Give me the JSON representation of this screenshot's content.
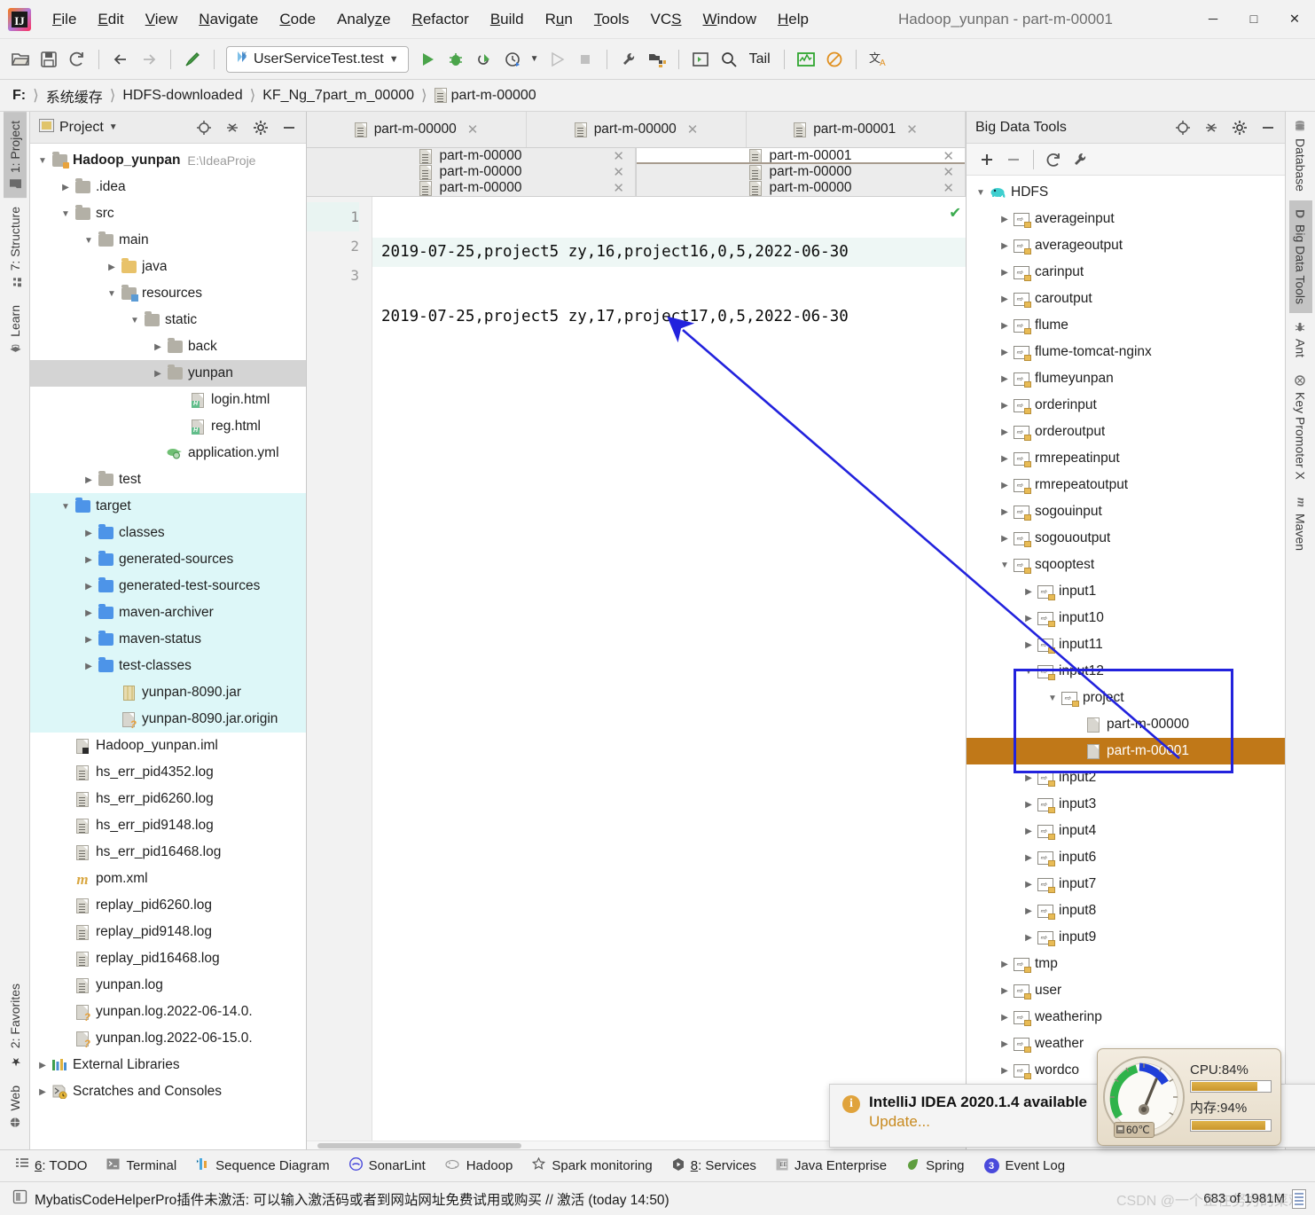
{
  "window": {
    "title": "Hadoop_yunpan - part-m-00001",
    "minimize": "─",
    "maximize": "□",
    "close": "✕"
  },
  "menu": [
    {
      "label": "File",
      "accel": "F"
    },
    {
      "label": "Edit",
      "accel": "E"
    },
    {
      "label": "View",
      "accel": "V"
    },
    {
      "label": "Navigate",
      "accel": "N"
    },
    {
      "label": "Code",
      "accel": "C"
    },
    {
      "label": "Analyze",
      "accel": "z"
    },
    {
      "label": "Refactor",
      "accel": "R"
    },
    {
      "label": "Build",
      "accel": "B"
    },
    {
      "label": "Run",
      "accel": "n"
    },
    {
      "label": "Tools",
      "accel": "T"
    },
    {
      "label": "VCS",
      "accel": "S"
    },
    {
      "label": "Window",
      "accel": "W"
    },
    {
      "label": "Help",
      "accel": "H"
    }
  ],
  "toolbar": {
    "run_config": "UserServiceTest.test",
    "tail_label": "Tail",
    "icons": [
      "open-folder-icon",
      "save-icon",
      "sync-icon",
      "back-arrow-icon",
      "forward-arrow-icon",
      "hammer-icon",
      "run-icon",
      "debug-icon",
      "run-coverage-icon",
      "profile-icon",
      "profile-dropdown-icon",
      "run-disabled-icon",
      "stop-disabled-icon",
      "wrench-icon",
      "project-structure-icon",
      "console-icon",
      "search-icon",
      "chart-icon",
      "no-entry-icon",
      "translate-icon"
    ]
  },
  "breadcrumbs": [
    {
      "label": "F:",
      "icon": null
    },
    {
      "label": "系统缓存",
      "icon": null
    },
    {
      "label": "HDFS-downloaded",
      "icon": null
    },
    {
      "label": "KF_Ng_7part_m_00000",
      "icon": null
    },
    {
      "label": "part-m-00000",
      "icon": "file-icon"
    }
  ],
  "left_stripe": {
    "top": [
      {
        "label": "1: Project",
        "icon": "folder-icon",
        "active": true
      },
      {
        "label": "7: Structure",
        "icon": "structure-icon",
        "active": false
      },
      {
        "label": "Learn",
        "icon": "graduation-cap-icon",
        "active": false
      }
    ],
    "bottom": [
      {
        "label": "2: Favorites",
        "icon": "star-icon",
        "active": false
      },
      {
        "label": "Web",
        "icon": "globe-icon",
        "active": false
      }
    ]
  },
  "right_stripe": [
    {
      "label": "Database",
      "icon": "database-icon",
      "active": false
    },
    {
      "label": "Big Data Tools",
      "icon": "big-data-icon",
      "active": true
    },
    {
      "label": "Ant",
      "icon": "ant-icon",
      "active": false
    },
    {
      "label": "Key Promoter X",
      "icon": "key-promoter-icon",
      "active": false
    },
    {
      "label": "Maven",
      "icon": "maven-icon",
      "active": false
    }
  ],
  "project_panel": {
    "title": "Project",
    "header_icons": [
      "locate-icon",
      "collapse-all-icon",
      "gear-icon",
      "hide-icon"
    ],
    "tree": [
      {
        "depth": 0,
        "label": "Hadoop_yunpan",
        "path": "E:\\IdeaProje",
        "icon": "module-folder-icon",
        "arrow": "down",
        "bold": true
      },
      {
        "depth": 1,
        "label": ".idea",
        "icon": "folder-grey-icon",
        "arrow": "right"
      },
      {
        "depth": 1,
        "label": "src",
        "icon": "folder-grey-icon",
        "arrow": "down"
      },
      {
        "depth": 2,
        "label": "main",
        "icon": "folder-grey-icon",
        "arrow": "down"
      },
      {
        "depth": 3,
        "label": "java",
        "icon": "folder-source-icon",
        "arrow": "right"
      },
      {
        "depth": 3,
        "label": "resources",
        "icon": "folder-resources-icon",
        "arrow": "down"
      },
      {
        "depth": 4,
        "label": "static",
        "icon": "folder-grey-icon",
        "arrow": "down"
      },
      {
        "depth": 5,
        "label": "back",
        "icon": "folder-grey-icon",
        "arrow": "right"
      },
      {
        "depth": 5,
        "label": "yunpan",
        "icon": "folder-grey-icon",
        "arrow": "right",
        "selected": true
      },
      {
        "depth": 6,
        "label": "login.html",
        "icon": "html-file-icon",
        "arrow": "none"
      },
      {
        "depth": 6,
        "label": "reg.html",
        "icon": "html-file-icon",
        "arrow": "none"
      },
      {
        "depth": 5,
        "label": "application.yml",
        "icon": "yml-file-icon",
        "arrow": "none"
      },
      {
        "depth": 2,
        "label": "test",
        "icon": "folder-grey-icon",
        "arrow": "right"
      },
      {
        "depth": 1,
        "label": "target",
        "icon": "folder-blue-icon",
        "arrow": "down",
        "excluded": true
      },
      {
        "depth": 2,
        "label": "classes",
        "icon": "folder-blue-icon",
        "arrow": "right",
        "excluded": true
      },
      {
        "depth": 2,
        "label": "generated-sources",
        "icon": "folder-blue-icon",
        "arrow": "right",
        "excluded": true
      },
      {
        "depth": 2,
        "label": "generated-test-sources",
        "icon": "folder-blue-icon",
        "arrow": "right",
        "excluded": true
      },
      {
        "depth": 2,
        "label": "maven-archiver",
        "icon": "folder-blue-icon",
        "arrow": "right",
        "excluded": true
      },
      {
        "depth": 2,
        "label": "maven-status",
        "icon": "folder-blue-icon",
        "arrow": "right",
        "excluded": true
      },
      {
        "depth": 2,
        "label": "test-classes",
        "icon": "folder-blue-icon",
        "arrow": "right",
        "excluded": true
      },
      {
        "depth": 3,
        "label": "yunpan-8090.jar",
        "icon": "jar-file-icon",
        "arrow": "none",
        "excluded": true
      },
      {
        "depth": 3,
        "label": "yunpan-8090.jar.origin",
        "icon": "unknown-file-icon",
        "arrow": "none",
        "excluded": true
      },
      {
        "depth": 1,
        "label": "Hadoop_yunpan.iml",
        "icon": "iml-file-icon",
        "arrow": "none"
      },
      {
        "depth": 1,
        "label": "hs_err_pid4352.log",
        "icon": "log-file-icon",
        "arrow": "none"
      },
      {
        "depth": 1,
        "label": "hs_err_pid6260.log",
        "icon": "log-file-icon",
        "arrow": "none"
      },
      {
        "depth": 1,
        "label": "hs_err_pid9148.log",
        "icon": "log-file-icon",
        "arrow": "none"
      },
      {
        "depth": 1,
        "label": "hs_err_pid16468.log",
        "icon": "log-file-icon",
        "arrow": "none"
      },
      {
        "depth": 1,
        "label": "pom.xml",
        "icon": "maven-file-icon",
        "arrow": "none"
      },
      {
        "depth": 1,
        "label": "replay_pid6260.log",
        "icon": "log-file-icon",
        "arrow": "none"
      },
      {
        "depth": 1,
        "label": "replay_pid9148.log",
        "icon": "log-file-icon",
        "arrow": "none"
      },
      {
        "depth": 1,
        "label": "replay_pid16468.log",
        "icon": "log-file-icon",
        "arrow": "none"
      },
      {
        "depth": 1,
        "label": "yunpan.log",
        "icon": "log-file-icon",
        "arrow": "none"
      },
      {
        "depth": 1,
        "label": "yunpan.log.2022-06-14.0.",
        "icon": "unknown-file-icon",
        "arrow": "none"
      },
      {
        "depth": 1,
        "label": "yunpan.log.2022-06-15.0.",
        "icon": "unknown-file-icon",
        "arrow": "none"
      },
      {
        "depth": 0,
        "label": "External Libraries",
        "icon": "libraries-icon",
        "arrow": "right"
      },
      {
        "depth": 0,
        "label": "Scratches and Consoles",
        "icon": "scratches-icon",
        "arrow": "right"
      }
    ]
  },
  "editor": {
    "tabs_row1": [
      {
        "label": "part-m-00000",
        "active": false
      },
      {
        "label": "part-m-00000",
        "active": false
      },
      {
        "label": "part-m-00001",
        "active": false
      }
    ],
    "tabs_split": [
      [
        {
          "label": "part-m-00000",
          "active": false
        },
        {
          "label": "part-m-00000",
          "active": false
        },
        {
          "label": "part-m-00000",
          "active": false
        }
      ],
      [
        {
          "label": "part-m-00001",
          "active": true
        },
        {
          "label": "part-m-00000",
          "active": false
        },
        {
          "label": "part-m-00000",
          "active": false
        }
      ]
    ],
    "line_numbers": [
      "1",
      "2",
      "3"
    ],
    "lines": [
      "2019-07-25,project5 zy,16,project16,0,5,2022-06-30",
      "2019-07-25,project5 zy,17,project17,0,5,2022-06-30",
      ""
    ]
  },
  "bdt_panel": {
    "title": "Big Data Tools",
    "header_icons": [
      "locate-icon",
      "collapse-all-icon",
      "gear-icon",
      "hide-icon"
    ],
    "toolbar_icons": [
      "add-icon",
      "remove-icon",
      "refresh-icon",
      "wrench-icon"
    ],
    "tree": [
      {
        "depth": 0,
        "label": "HDFS",
        "icon": "hadoop-elephant-icon",
        "arrow": "down"
      },
      {
        "depth": 1,
        "label": "averageinput",
        "icon": "hdfs-folder-icon",
        "arrow": "right"
      },
      {
        "depth": 1,
        "label": "averageoutput",
        "icon": "hdfs-folder-icon",
        "arrow": "right"
      },
      {
        "depth": 1,
        "label": "carinput",
        "icon": "hdfs-folder-icon",
        "arrow": "right"
      },
      {
        "depth": 1,
        "label": "caroutput",
        "icon": "hdfs-folder-icon",
        "arrow": "right"
      },
      {
        "depth": 1,
        "label": "flume",
        "icon": "hdfs-folder-icon",
        "arrow": "right"
      },
      {
        "depth": 1,
        "label": "flume-tomcat-nginx",
        "icon": "hdfs-folder-icon",
        "arrow": "right"
      },
      {
        "depth": 1,
        "label": "flumeyunpan",
        "icon": "hdfs-folder-icon",
        "arrow": "right"
      },
      {
        "depth": 1,
        "label": "orderinput",
        "icon": "hdfs-folder-icon",
        "arrow": "right"
      },
      {
        "depth": 1,
        "label": "orderoutput",
        "icon": "hdfs-folder-icon",
        "arrow": "right"
      },
      {
        "depth": 1,
        "label": "rmrepeatinput",
        "icon": "hdfs-folder-icon",
        "arrow": "right"
      },
      {
        "depth": 1,
        "label": "rmrepeatoutput",
        "icon": "hdfs-folder-icon",
        "arrow": "right"
      },
      {
        "depth": 1,
        "label": "sogouinput",
        "icon": "hdfs-folder-icon",
        "arrow": "right"
      },
      {
        "depth": 1,
        "label": "sogououtput",
        "icon": "hdfs-folder-icon",
        "arrow": "right"
      },
      {
        "depth": 1,
        "label": "sqooptest",
        "icon": "hdfs-folder-icon",
        "arrow": "down"
      },
      {
        "depth": 2,
        "label": "input1",
        "icon": "hdfs-folder-icon",
        "arrow": "right"
      },
      {
        "depth": 2,
        "label": "input10",
        "icon": "hdfs-folder-icon",
        "arrow": "right"
      },
      {
        "depth": 2,
        "label": "input11",
        "icon": "hdfs-folder-icon",
        "arrow": "right"
      },
      {
        "depth": 2,
        "label": "input12",
        "icon": "hdfs-folder-icon",
        "arrow": "down"
      },
      {
        "depth": 3,
        "label": "project",
        "icon": "hdfs-folder-icon",
        "arrow": "down"
      },
      {
        "depth": 4,
        "label": "part-m-00000",
        "icon": "hdfs-file-icon",
        "arrow": "none"
      },
      {
        "depth": 4,
        "label": "part-m-00001",
        "icon": "hdfs-file-icon",
        "arrow": "none",
        "selected": true
      },
      {
        "depth": 2,
        "label": "input2",
        "icon": "hdfs-folder-icon",
        "arrow": "right"
      },
      {
        "depth": 2,
        "label": "input3",
        "icon": "hdfs-folder-icon",
        "arrow": "right"
      },
      {
        "depth": 2,
        "label": "input4",
        "icon": "hdfs-folder-icon",
        "arrow": "right"
      },
      {
        "depth": 2,
        "label": "input6",
        "icon": "hdfs-folder-icon",
        "arrow": "right"
      },
      {
        "depth": 2,
        "label": "input7",
        "icon": "hdfs-folder-icon",
        "arrow": "right"
      },
      {
        "depth": 2,
        "label": "input8",
        "icon": "hdfs-folder-icon",
        "arrow": "right"
      },
      {
        "depth": 2,
        "label": "input9",
        "icon": "hdfs-folder-icon",
        "arrow": "right"
      },
      {
        "depth": 1,
        "label": "tmp",
        "icon": "hdfs-folder-icon",
        "arrow": "right"
      },
      {
        "depth": 1,
        "label": "user",
        "icon": "hdfs-folder-icon",
        "arrow": "right"
      },
      {
        "depth": 1,
        "label": "weatherinp",
        "icon": "hdfs-folder-icon",
        "arrow": "right"
      },
      {
        "depth": 1,
        "label": "weather",
        "icon": "hdfs-folder-icon",
        "arrow": "right"
      },
      {
        "depth": 1,
        "label": "wordco",
        "icon": "hdfs-folder-icon",
        "arrow": "right"
      }
    ]
  },
  "notification": {
    "title": "IntelliJ IDEA 2020.1.4 available",
    "link": "Update...",
    "info_glyph": "i"
  },
  "gauge": {
    "cpu_label": "CPU:84%",
    "cpu_percent": 84,
    "mem_label": "内存:94%",
    "mem_percent": 94,
    "temp_label": "60℃"
  },
  "bottom_tabs": [
    {
      "label": "6: TODO",
      "accel": "6",
      "icon": "todo-icon"
    },
    {
      "label": "Terminal",
      "accel": "",
      "icon": "terminal-icon"
    },
    {
      "label": "Sequence Diagram",
      "accel": "",
      "icon": "sequence-diagram-icon"
    },
    {
      "label": "SonarLint",
      "accel": "",
      "icon": "sonarlint-icon"
    },
    {
      "label": "Hadoop",
      "accel": "",
      "icon": "hadoop-icon"
    },
    {
      "label": "Spark monitoring",
      "accel": "",
      "icon": "star-outline-icon"
    },
    {
      "label": "8: Services",
      "accel": "8",
      "icon": "services-icon"
    },
    {
      "label": "Java Enterprise",
      "accel": "",
      "icon": "java-enterprise-icon"
    },
    {
      "label": "Spring",
      "accel": "",
      "icon": "spring-leaf-icon"
    },
    {
      "label": "Event Log",
      "accel": "",
      "icon": "event-log-icon",
      "badge": "3"
    }
  ],
  "statusbar": {
    "message": "MybatisCodeHelperPro插件未激活: 可以输入激活码或者到网站网址免费试用或购买 // 激活 (today 14:50)",
    "memory": "683 of 1981M",
    "watermark": "CSDN @一个正在努力的菜鸡"
  },
  "colors": {
    "accent_blue": "#2222dd",
    "selection_orange": "#c07818",
    "excluded_cyan": "#ddf7f8",
    "notif_orange": "#c88a1f"
  }
}
